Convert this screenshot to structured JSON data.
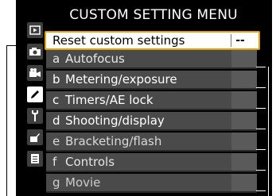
{
  "menu": {
    "title": "CUSTOM SETTING MENU",
    "reset": {
      "label": "Reset custom settings",
      "value": "--"
    },
    "groups": [
      {
        "letter": "a",
        "label": "Autofocus",
        "color": "#e8e8e8"
      },
      {
        "letter": "b",
        "label": "Metering/exposure",
        "color": "#ffffff"
      },
      {
        "letter": "c",
        "label": "Timers/AE lock",
        "color": "#ffffff"
      },
      {
        "letter": "d",
        "label": "Shooting/display",
        "color": "#ffffff"
      },
      {
        "letter": "e",
        "label": "Bracketing/flash",
        "color": "#d9d9d9"
      },
      {
        "letter": "f",
        "label": "Controls",
        "color": "#e6e6e6"
      },
      {
        "letter": "g",
        "label": "Movie",
        "color": "#cccccc"
      }
    ]
  },
  "tabs": [
    {
      "icon": "playback-icon",
      "active": false
    },
    {
      "icon": "camera-icon",
      "active": false
    },
    {
      "icon": "movie-camera-icon",
      "active": false
    },
    {
      "icon": "pencil-icon",
      "active": true
    },
    {
      "icon": "wrench-icon",
      "active": false
    },
    {
      "icon": "retouch-icon",
      "active": false
    },
    {
      "icon": "my-menu-icon",
      "active": false
    }
  ],
  "colors": {
    "screen": "#000000",
    "selected_border": "#e8a100",
    "row_background": "#4a4a4a"
  }
}
